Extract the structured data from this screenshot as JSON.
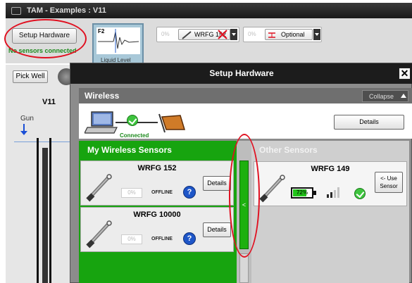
{
  "app": {
    "title": "TAM - Examples : V11"
  },
  "toolbar": {
    "setup_hardware_label": "Setup Hardware",
    "no_sensors_text": "No sensors connected",
    "liquid_tile": {
      "key": "F2",
      "label": "Liquid Level"
    },
    "slots": [
      {
        "percent": "0%",
        "name": "WRFG 152",
        "status": "disconnected"
      },
      {
        "percent": "0%",
        "name": "Optional"
      }
    ]
  },
  "left_panel": {
    "pick_well_label": "Pick Well",
    "well_name": "V11",
    "gun_label": "Gun"
  },
  "dialog": {
    "title": "Setup Hardware",
    "close_glyph": "✕",
    "section_title": "Wireless",
    "collapse_label": "Collapse",
    "connected_label": "Connected",
    "details_label": "Details",
    "my_sensors_title": "My Wireless Sensors",
    "other_sensors_title": "Other Sensors",
    "transfer_glyph": "<",
    "my_sensors": [
      {
        "name": "WRFG 152",
        "percent": "0%",
        "status": "OFFLINE",
        "help": "?",
        "details": "Details"
      },
      {
        "name": "WRFG 10000",
        "percent": "0%",
        "status": "OFFLINE",
        "help": "?",
        "details": "Details"
      }
    ],
    "other_sensors": [
      {
        "name": "WRFG 149",
        "battery": "72%",
        "battery_level": 0.72,
        "use_line1": "<- Use",
        "use_line2": "Sensor"
      }
    ]
  },
  "colors": {
    "accent_green": "#17a40f",
    "connected_green": "#1d8a1d",
    "annotation_red": "#e01020",
    "help_blue": "#1e56c8"
  },
  "icons": [
    "logo-icon",
    "laptop-icon",
    "check-icon",
    "antenna-icon",
    "probe-icon",
    "help-icon",
    "battery-icon",
    "signal-icon",
    "close-icon",
    "dropdown-icon",
    "down-arrow-icon"
  ]
}
